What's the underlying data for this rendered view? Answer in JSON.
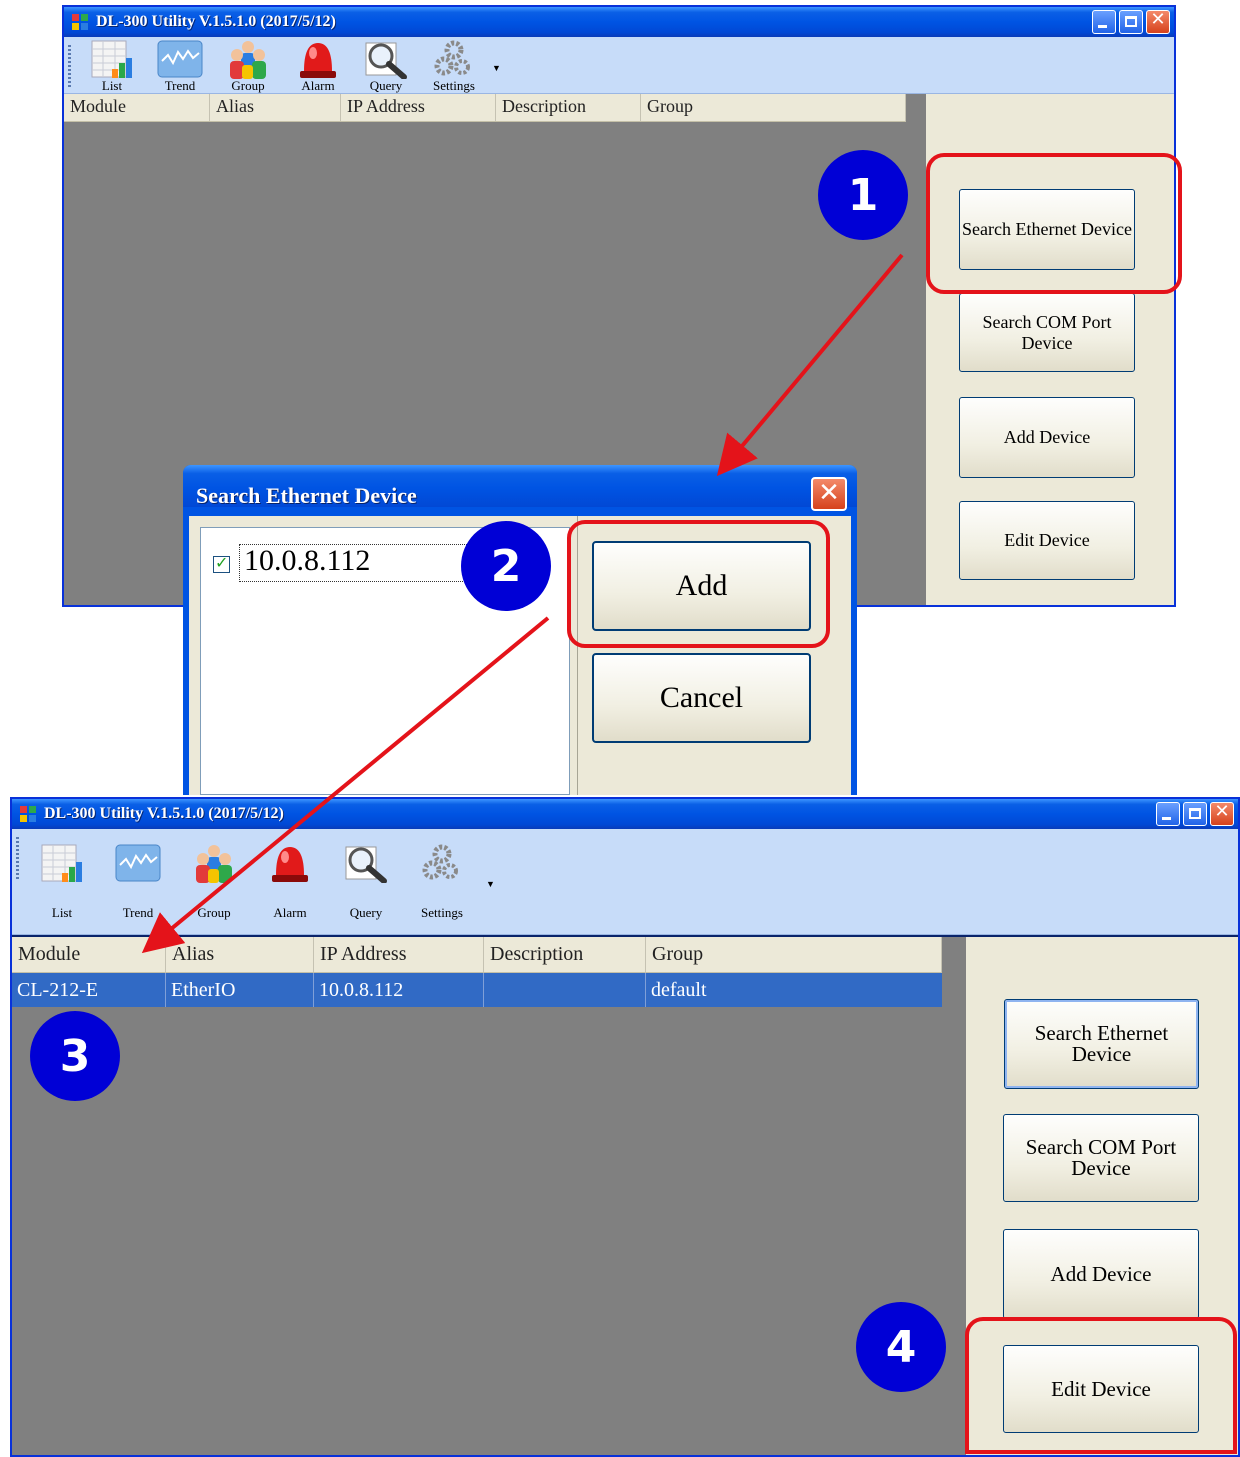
{
  "app": {
    "title": "DL-300 Utility V.1.5.1.0 (2017/5/12)",
    "toolbar": [
      "List",
      "Trend",
      "Group",
      "Alarm",
      "Query",
      "Settings"
    ],
    "columns": [
      "Module",
      "Alias",
      "IP Address",
      "Description",
      "Group"
    ],
    "buttons": {
      "search_ethernet": "Search Ethernet Device",
      "search_com": "Search COM Port Device",
      "add_device": "Add Device",
      "edit_device": "Edit Device"
    }
  },
  "dialog": {
    "title": "Search Ethernet Device",
    "device_ip": "10.0.8.112",
    "device_checked": true,
    "add_label": "Add",
    "cancel_label": "Cancel"
  },
  "device_row": {
    "module": "CL-212-E",
    "alias": "EtherIO",
    "ip": "10.0.8.112",
    "description": "",
    "group": "default"
  },
  "steps": [
    "1",
    "2",
    "3",
    "4"
  ],
  "colors": {
    "highlight": "#e4131a",
    "badge": "#0000d6",
    "arrow": "#e4131a",
    "selected_row": "#316ac5"
  },
  "icons": [
    "list-icon",
    "trend-icon",
    "group-icon",
    "alarm-icon",
    "query-icon",
    "settings-icon"
  ]
}
